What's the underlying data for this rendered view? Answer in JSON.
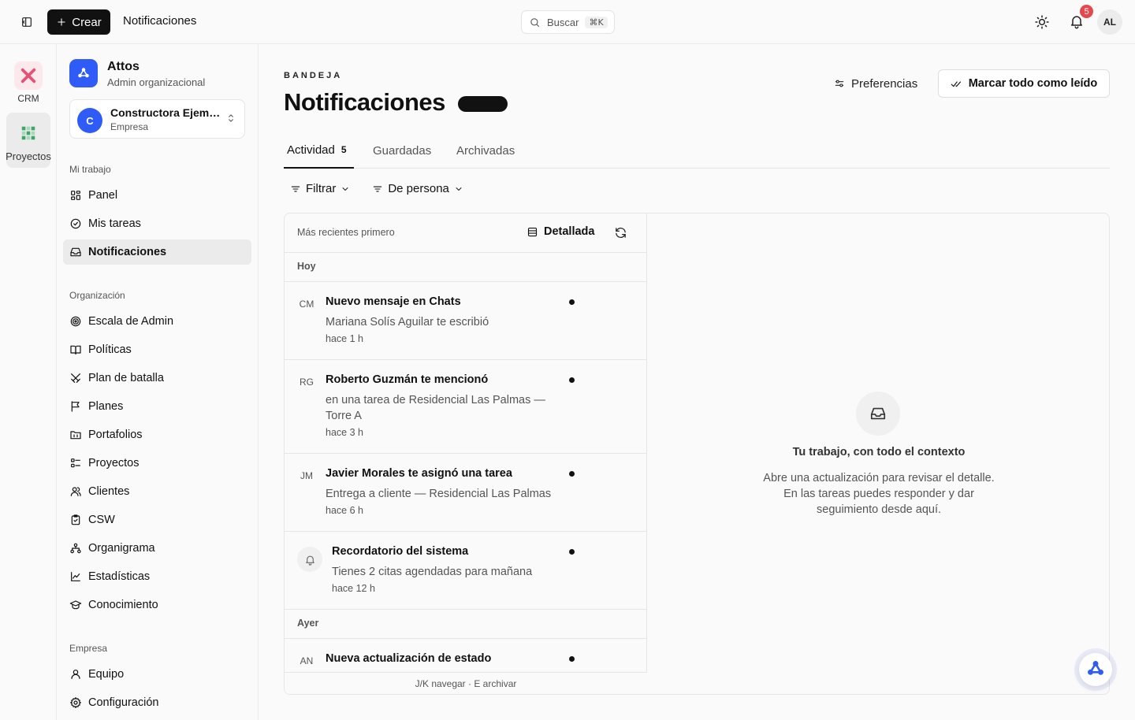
{
  "topbar": {
    "create_label": "Crear",
    "title": "Notificaciones",
    "search_placeholder": "Buscar",
    "search_shortcut": "⌘K",
    "notif_count": "5",
    "user_initials": "AL"
  },
  "rail": {
    "items": [
      {
        "label": "CRM"
      },
      {
        "label": "Proyectos"
      }
    ]
  },
  "sidebar": {
    "org_name": "Attos",
    "org_role": "Admin organizacional",
    "company_initial": "C",
    "company_name": "Constructora Ejemplo",
    "company_type": "Empresa",
    "sections": [
      {
        "title": "Mi trabajo",
        "items": [
          {
            "label": "Panel",
            "icon": "grid-icon"
          },
          {
            "label": "Mis tareas",
            "icon": "check-circle-icon"
          },
          {
            "label": "Notificaciones",
            "icon": "inbox-icon",
            "active": true
          }
        ]
      },
      {
        "title": "Organización",
        "items": [
          {
            "label": "Escala de Admin",
            "icon": "target-icon"
          },
          {
            "label": "Políticas",
            "icon": "book-icon"
          },
          {
            "label": "Plan de batalla",
            "icon": "crossed-swords-icon"
          },
          {
            "label": "Planes",
            "icon": "flag-icon"
          },
          {
            "label": "Portafolios",
            "icon": "folder-icon"
          },
          {
            "label": "Proyectos",
            "icon": "list-icon"
          },
          {
            "label": "Clientes",
            "icon": "users-icon"
          },
          {
            "label": "CSW",
            "icon": "clipboard-icon"
          },
          {
            "label": "Organigrama",
            "icon": "org-chart-icon"
          },
          {
            "label": "Estadísticas",
            "icon": "chart-icon"
          },
          {
            "label": "Conocimiento",
            "icon": "graduation-cap-icon"
          }
        ]
      },
      {
        "title": "Empresa",
        "items": [
          {
            "label": "Equipo",
            "icon": "user-icon"
          },
          {
            "label": "Configuración",
            "icon": "gear-icon"
          }
        ]
      }
    ]
  },
  "main": {
    "eyebrow": "BANDEJA",
    "title": "Notificaciones",
    "preferences_label": "Preferencias",
    "mark_all_label": "Marcar todo como leído",
    "tabs": [
      {
        "label": "Actividad",
        "count": "5",
        "active": true
      },
      {
        "label": "Guardadas"
      },
      {
        "label": "Archivadas"
      }
    ],
    "filters": [
      {
        "label": "Filtrar"
      },
      {
        "label": "De persona"
      }
    ],
    "list": {
      "sort_label": "Más recientes primero",
      "view_label": "Detallada",
      "groups": [
        "Hoy",
        "Ayer"
      ],
      "items": [
        {
          "avatar": "CM",
          "title": "Nuevo mensaje en Chats",
          "desc": "Mariana Solís Aguilar te escribió",
          "time": "hace 1 h"
        },
        {
          "avatar": "RG",
          "title": "Roberto Guzmán te mencionó",
          "desc": "en una tarea de Residencial Las Palmas — Torre A",
          "time": "hace 3 h"
        },
        {
          "avatar": "JM",
          "title": "Javier Morales te asignó una tarea",
          "desc": "Entrega a cliente — Residencial Las Palmas",
          "time": "hace 6 h"
        },
        {
          "avatar": "",
          "title": "Recordatorio del sistema",
          "desc": "Tienes 2 citas agendadas para mañana",
          "time": "hace 12 h"
        },
        {
          "avatar": "AN",
          "title": "Nueva actualización de estado",
          "desc": "",
          "time": ""
        }
      ],
      "footer": "J/K navegar · E archivar"
    },
    "detail": {
      "empty_title": "Tu trabajo, con todo el contexto",
      "empty_desc": "Abre una actualización para revisar el detalle. En las tareas puedes responder y dar seguimiento desde aquí."
    }
  },
  "colors": {
    "accent": "#2f5cf6",
    "badge": "#e5484d",
    "crm": "#e94e77",
    "projects": "#3fa66a"
  }
}
